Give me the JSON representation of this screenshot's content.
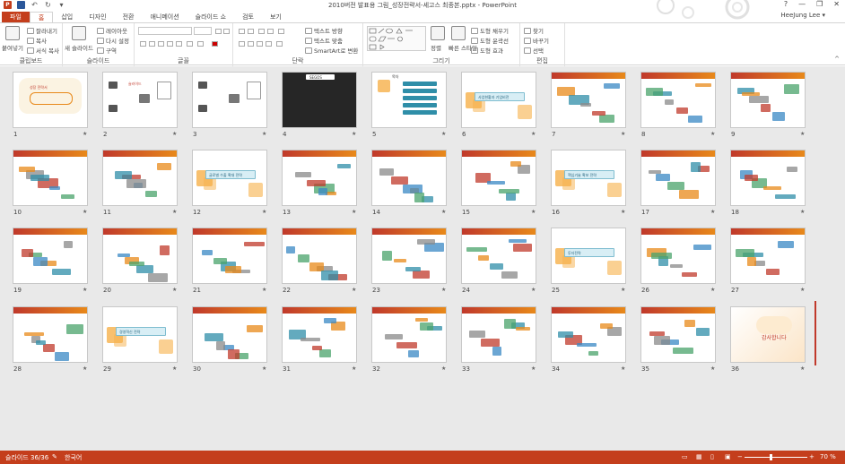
{
  "title_bar": {
    "document_title": "2010버전 발표용 그림_성장전략서-세고스 최종본.pptx - PowerPoint",
    "controls": [
      "?",
      "—",
      "❐",
      "✕"
    ],
    "qat_icons": [
      "powerpoint-icon",
      "save-icon",
      "undo-icon",
      "redo-icon",
      "customize-icon"
    ]
  },
  "tabs": [
    "파일",
    "홈",
    "삽입",
    "디자인",
    "전환",
    "애니메이션",
    "슬라이드 쇼",
    "검토",
    "보기"
  ],
  "user_name": "HeeJung Lee",
  "ribbon": {
    "clipboard": {
      "label": "클립보드",
      "paste": "붙여넣기",
      "cut": "잘라내기",
      "copy": "복사",
      "format_painter": "서식 복사"
    },
    "slides": {
      "label": "슬라이드",
      "new_slide": "새 슬라이드",
      "layout": "레이아웃",
      "reset": "다시 설정",
      "section": "구역"
    },
    "font": {
      "label": "글꼴"
    },
    "paragraph": {
      "label": "단락",
      "text_direction": "텍스트 방향",
      "align_text": "텍스트 맞춤",
      "smartart": "SmartArt로 변환"
    },
    "drawing": {
      "label": "그리기",
      "arrange": "정렬",
      "quick_styles": "빠른 스타일",
      "shape_fill": "도형 채우기",
      "shape_outline": "도형 윤곽선",
      "shape_effects": "도형 효과"
    },
    "editing": {
      "label": "편집",
      "find": "찾기",
      "replace": "바꾸기",
      "select": "선택"
    }
  },
  "slides": [
    {
      "n": "1",
      "t": "성장 전략서"
    },
    {
      "n": "2",
      "t": "슬라이드"
    },
    {
      "n": "3",
      "t": ""
    },
    {
      "n": "4",
      "t": "SEGOS"
    },
    {
      "n": "5",
      "t": "목차"
    },
    {
      "n": "6",
      "t": "사업현황과 기업비전"
    },
    {
      "n": "7",
      "t": ""
    },
    {
      "n": "8",
      "t": ""
    },
    {
      "n": "9",
      "t": ""
    },
    {
      "n": "10",
      "t": ""
    },
    {
      "n": "11",
      "t": ""
    },
    {
      "n": "12",
      "t": "글로벌 수출 확대 전략"
    },
    {
      "n": "13",
      "t": ""
    },
    {
      "n": "14",
      "t": ""
    },
    {
      "n": "15",
      "t": ""
    },
    {
      "n": "16",
      "t": "핵심기술 확보 전략"
    },
    {
      "n": "17",
      "t": ""
    },
    {
      "n": "18",
      "t": ""
    },
    {
      "n": "19",
      "t": ""
    },
    {
      "n": "20",
      "t": ""
    },
    {
      "n": "21",
      "t": ""
    },
    {
      "n": "22",
      "t": ""
    },
    {
      "n": "23",
      "t": ""
    },
    {
      "n": "24",
      "t": ""
    },
    {
      "n": "25",
      "t": "투자전략"
    },
    {
      "n": "26",
      "t": ""
    },
    {
      "n": "27",
      "t": ""
    },
    {
      "n": "28",
      "t": ""
    },
    {
      "n": "29",
      "t": "경영혁신 전략"
    },
    {
      "n": "30",
      "t": ""
    },
    {
      "n": "31",
      "t": ""
    },
    {
      "n": "32",
      "t": ""
    },
    {
      "n": "33",
      "t": ""
    },
    {
      "n": "34",
      "t": ""
    },
    {
      "n": "35",
      "t": ""
    },
    {
      "n": "36",
      "t": "감사합니다"
    }
  ],
  "status_bar": {
    "slide_count": "슬라이드 36/36",
    "language": "한국어",
    "zoom": "70 %"
  },
  "colors": {
    "accent": "#c43e1c",
    "sorter_bg": "#e9e9e9"
  }
}
